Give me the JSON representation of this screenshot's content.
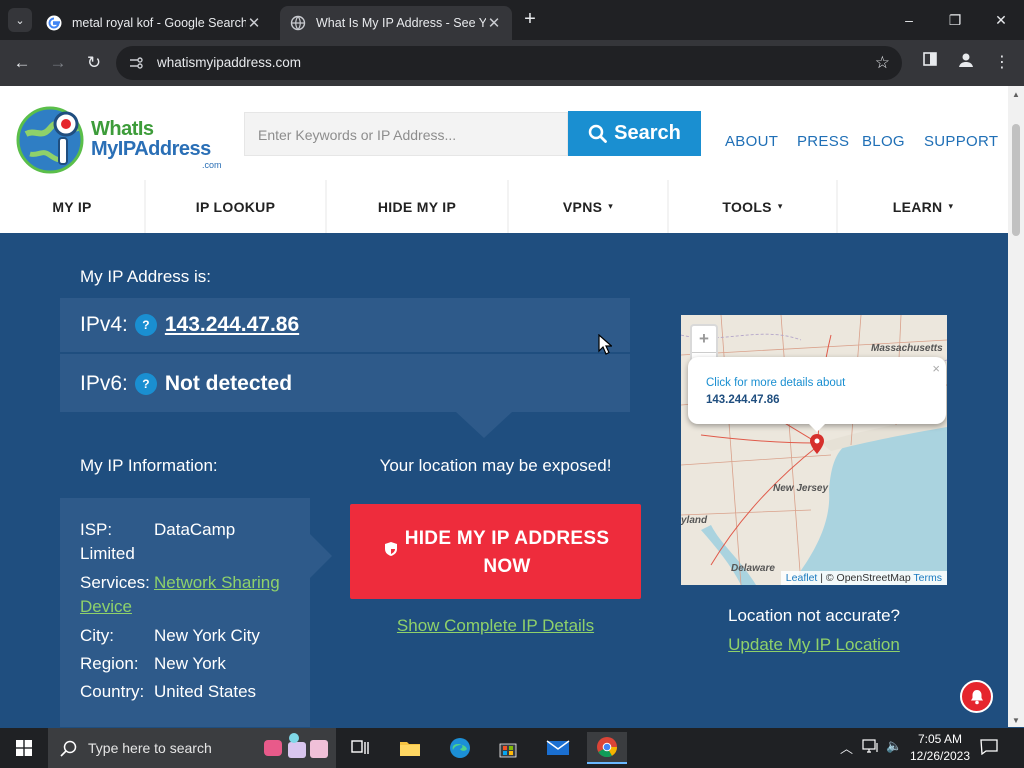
{
  "browser": {
    "tabs": [
      {
        "title": "metal royal kof - Google Search",
        "active": false
      },
      {
        "title": "What Is My IP Address - See Your",
        "active": true
      }
    ],
    "new_tab": "+",
    "url": "whatismyipaddress.com",
    "window": {
      "minimize": "–",
      "maximize": "❐",
      "close": "✕"
    }
  },
  "site": {
    "logo": {
      "word1": "WhatIs",
      "word2": "MyIPAddress",
      "com": ".com"
    },
    "search_placeholder": "Enter Keywords or IP Address...",
    "search_button": "Search",
    "top_links": [
      "ABOUT",
      "PRESS",
      "BLOG",
      "SUPPORT"
    ],
    "nav": [
      {
        "label": "MY IP",
        "caret": ""
      },
      {
        "label": "IP LOOKUP",
        "caret": ""
      },
      {
        "label": "HIDE MY IP",
        "caret": ""
      },
      {
        "label": "VPNS",
        "caret": "▾"
      },
      {
        "label": "TOOLS",
        "caret": "▾"
      },
      {
        "label": "LEARN",
        "caret": "▾"
      }
    ],
    "ip_heading": "My IP Address is:",
    "ipv4": {
      "label": "IPv4:",
      "help": "?",
      "value": "143.244.47.86"
    },
    "ipv6": {
      "label": "IPv6:",
      "help": "?",
      "value": "Not detected"
    },
    "info_heading": "My IP Information:",
    "info": {
      "isp": {
        "key": "ISP:",
        "value": "DataCamp",
        "cont": "Limited"
      },
      "services": {
        "key": "Services:",
        "value": "Network Sharing",
        "cont": "Device"
      },
      "city": {
        "key": "City:",
        "value": "New York City"
      },
      "region": {
        "key": "Region:",
        "value": "New York"
      },
      "country": {
        "key": "Country:",
        "value": "United States"
      }
    },
    "exposed": "Your location may be exposed!",
    "hide_button": "HIDE MY IP ADDRESS NOW",
    "complete_link": "Show Complete IP Details",
    "map": {
      "zoom_in": "+",
      "zoom_out": "−",
      "popup_text": "Click for more details about",
      "popup_ip": "143.244.47.86",
      "popup_close": "×",
      "labels": [
        "Massachusetts",
        "New Jersey",
        "yland",
        "Delaware"
      ],
      "attribution_leaflet": "Leaflet",
      "attribution_sep": " | © OpenStreetMap ",
      "attribution_terms": "Terms"
    },
    "not_accurate": "Location not accurate?",
    "update_link": "Update My IP Location"
  },
  "taskbar": {
    "search_text": "Type here to search",
    "time": "7:05 AM",
    "date": "12/26/2023"
  },
  "colors": {
    "page_bg": "#1f4e7f",
    "panel": "#2e5a8a",
    "accent_blue": "#1a8fd1",
    "cta_red": "#ee2c3c",
    "link_green": "#8fd16a"
  }
}
